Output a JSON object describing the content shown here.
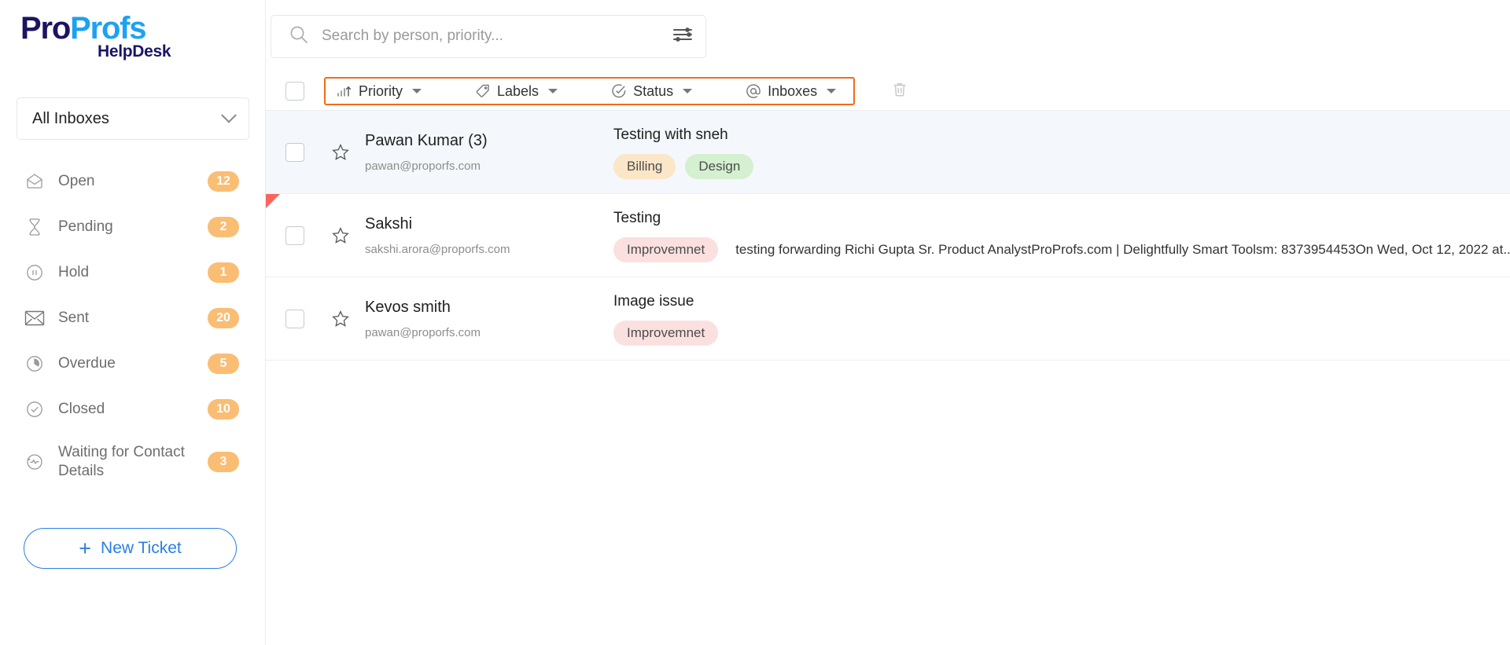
{
  "brand": {
    "name_part1": "Pro",
    "name_part2": "Profs",
    "product": "HelpDesk",
    "color_dark": "#1b1464",
    "color_light": "#1da1f2"
  },
  "sidebar": {
    "inbox_selector": {
      "label": "All Inboxes",
      "icon": "chevron-down-icon"
    },
    "items": [
      {
        "label": "Open",
        "badge": "12",
        "icon": "envelope-open-icon"
      },
      {
        "label": "Pending",
        "badge": "2",
        "icon": "hourglass-icon"
      },
      {
        "label": "Hold",
        "badge": "1",
        "icon": "pause-circle-icon"
      },
      {
        "label": "Sent",
        "badge": "20",
        "icon": "envelope-icon"
      },
      {
        "label": "Overdue",
        "badge": "5",
        "icon": "clock-icon"
      },
      {
        "label": "Closed",
        "badge": "10",
        "icon": "check-circle-icon"
      },
      {
        "label": "Waiting for Contact Details",
        "badge": "3",
        "icon": "activity-circle-icon"
      }
    ],
    "new_ticket": {
      "plus": "+",
      "label": "New Ticket"
    },
    "badge_color": "#fabd74",
    "accent_color": "#2b7de9"
  },
  "search": {
    "placeholder": "Search by person, priority...",
    "value": "",
    "search_icon": "search-icon",
    "filter_icon": "sliders-icon"
  },
  "filter_bar": {
    "highlight_color": "#ef6c1a",
    "filters": [
      {
        "label": "Priority",
        "icon": "priority-bars-icon"
      },
      {
        "label": "Labels",
        "icon": "tag-icon"
      },
      {
        "label": "Status",
        "icon": "check-circle-icon"
      },
      {
        "label": "Inboxes",
        "icon": "at-sign-icon"
      }
    ],
    "delete_icon": "trash-icon"
  },
  "tickets": [
    {
      "name": "Pawan Kumar (3)",
      "email": "pawan@proporfs.com",
      "subject": "Testing with sneh",
      "preview": "",
      "unread": true,
      "flagged": false,
      "starred": false,
      "labels": [
        {
          "text": "Billing",
          "bg": "#fbe6c8"
        },
        {
          "text": "Design",
          "bg": "#d4f0d0"
        }
      ]
    },
    {
      "name": "Sakshi",
      "email": "sakshi.arora@proporfs.com",
      "subject": "Testing",
      "preview": "testing forwarding Richi Gupta Sr. Product AnalystProProfs.com | Delightfully Smart Toolsm: 8373954453On Wed, Oct 12, 2022 at...",
      "unread": false,
      "flagged": true,
      "starred": false,
      "labels": [
        {
          "text": "Improvemnet",
          "bg": "#fbe0e0"
        }
      ]
    },
    {
      "name": "Kevos smith",
      "email": "pawan@proporfs.com",
      "subject": "Image issue",
      "preview": "",
      "unread": false,
      "flagged": false,
      "starred": false,
      "labels": [
        {
          "text": "Improvemnet",
          "bg": "#fbe0e0"
        }
      ]
    }
  ]
}
